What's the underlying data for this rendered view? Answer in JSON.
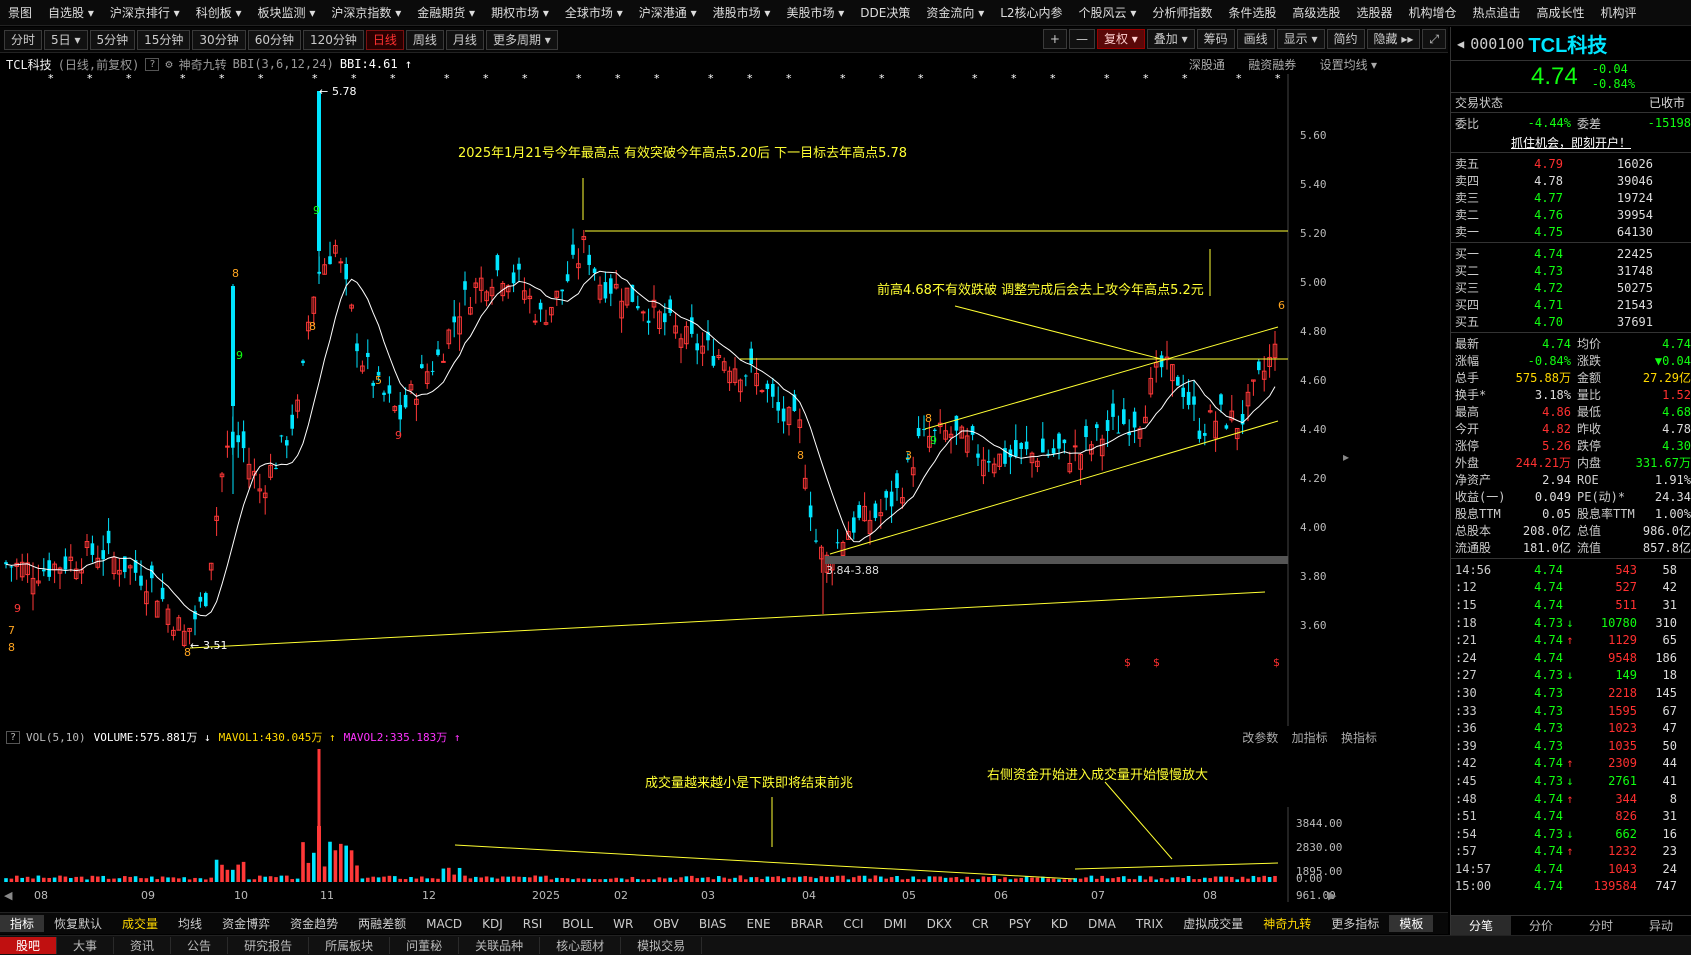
{
  "top_menu": [
    "景图",
    "自选股 ▾",
    "沪深京排行 ▾",
    "科创板 ▾",
    "板块监测 ▾",
    "沪深京指数 ▾",
    "金融期货 ▾",
    "期权市场 ▾",
    "全球市场 ▾",
    "沪深港通 ▾",
    "港股市场 ▾",
    "美股市场 ▾",
    "DDE决策",
    "资金流向 ▾",
    "L2核心内参",
    "个股风云 ▾",
    "分析师指数",
    "条件选股",
    "高级选股",
    "选股器",
    "机构增仓",
    "热点追击",
    "高成长性",
    "机构评"
  ],
  "periods": [
    "分时",
    "5日 ▾",
    "5分钟",
    "15分钟",
    "30分钟",
    "60分钟",
    "120分钟",
    "日线",
    "周线",
    "月线",
    "更多周期 ▾"
  ],
  "active_period": "日线",
  "toolbar_right": [
    "+",
    "—",
    "复权 ▾",
    "叠加 ▾",
    "筹码",
    "画线",
    "显示 ▾",
    "简约",
    "隐藏 ▸▸",
    "⤢"
  ],
  "info": {
    "name": "TCL科技",
    "mode": "(日线,前复权)",
    "help": "?",
    "indicator": "神奇九转",
    "bbi": "BBI(3,6,12,24)",
    "bbi_value": "BBI:4.61 ↑",
    "links": [
      "深股通",
      "融资融券",
      "设置均线 ▾"
    ]
  },
  "chart": {
    "y_ticks": [
      "5.60",
      "5.40",
      "5.20",
      "5.00",
      "4.80",
      "4.60",
      "4.40",
      "4.20",
      "4.00",
      "3.80",
      "3.60"
    ],
    "annotations": {
      "top_note": "2025年1月21号今年最高点 有效突破今年高点5.20后 下一目标去年高点5.78",
      "right_note": "前高4.68不有效跌破 调整完成后会去上攻今年高点5.2元",
      "high_label": "5.78",
      "low_label": "3.51",
      "range_label": "3.84-3.88"
    }
  },
  "vol_info": {
    "title": "VOL(5,10)",
    "volume": "VOLUME:575.881万 ↓",
    "mavol1": "MAVOL1:430.045万 ↑",
    "mavol2": "MAVOL2:335.183万 ↑",
    "links": [
      "改参数",
      "加指标",
      "换指标"
    ]
  },
  "vol": {
    "y_ticks": [
      "3844.00",
      "2830.00",
      "1895.00",
      "961.00",
      "0.00"
    ],
    "note_left": "成交量越来越小是下跌即将结束前兆",
    "note_right": "右侧资金开始进入成交量开始慢慢放大",
    "x_labels": [
      "08",
      "09",
      "10",
      "11",
      "12",
      "2025",
      "02",
      "03",
      "04",
      "05",
      "06",
      "07",
      "08"
    ]
  },
  "indicators": [
    "指标",
    "恢复默认",
    "成交量",
    "均线",
    "资金博弈",
    "资金趋势",
    "两融差额",
    "MACD",
    "KDJ",
    "RSI",
    "BOLL",
    "WR",
    "OBV",
    "BIAS",
    "ENE",
    "BRAR",
    "CCI",
    "DMI",
    "DKX",
    "CR",
    "PSY",
    "KD",
    "DMA",
    "TRIX",
    "虚拟成交量",
    "神奇九转",
    "更多指标",
    "模板"
  ],
  "bottom_tabs": [
    "股吧",
    "大事",
    "资讯",
    "公告",
    "研究报告",
    "所属板块",
    "问董秘",
    "关联品种",
    "核心题材",
    "模拟交易"
  ],
  "quote": {
    "code": "000100",
    "name": "TCL科技",
    "price": "4.74",
    "change": "-0.04",
    "change_pct": "-0.84%",
    "status_label": "交易状态",
    "status_value": "已收市",
    "weibi_label": "委比",
    "weibi": "-4.44%",
    "weicha_label": "委差",
    "weicha": "-15198",
    "promo": "抓住机会，即刻开户！",
    "asks": [
      [
        "卖五",
        "4.79",
        "16026"
      ],
      [
        "卖四",
        "4.78",
        "39046"
      ],
      [
        "卖三",
        "4.77",
        "19724"
      ],
      [
        "卖二",
        "4.76",
        "39954"
      ],
      [
        "卖一",
        "4.75",
        "64130"
      ]
    ],
    "bids": [
      [
        "买一",
        "4.74",
        "22425"
      ],
      [
        "买二",
        "4.73",
        "31748"
      ],
      [
        "买三",
        "4.72",
        "50275"
      ],
      [
        "买四",
        "4.71",
        "21543"
      ],
      [
        "买五",
        "4.70",
        "37691"
      ]
    ],
    "stats": [
      [
        "最新",
        "4.74",
        "均价",
        "4.74"
      ],
      [
        "涨幅",
        "-0.84%",
        "涨跌",
        "▼0.04"
      ],
      [
        "总手",
        "575.88万",
        "金额",
        "27.29亿"
      ],
      [
        "换手*",
        "3.18%",
        "量比",
        "1.52"
      ],
      [
        "最高",
        "4.86",
        "最低",
        "4.68"
      ],
      [
        "今开",
        "4.82",
        "昨收",
        "4.78"
      ],
      [
        "涨停",
        "5.26",
        "跌停",
        "4.30"
      ],
      [
        "外盘",
        "244.21万",
        "内盘",
        "331.67万"
      ],
      [
        "净资产",
        "2.94",
        "ROE",
        "1.91%"
      ],
      [
        "收益(一)",
        "0.049",
        "PE(动)*",
        "24.34"
      ],
      [
        "股息TTM",
        "0.05",
        "股息率TTM",
        "1.00%"
      ],
      [
        "总股本",
        "208.0亿",
        "总值",
        "986.0亿"
      ],
      [
        "流通股",
        "181.0亿",
        "流值",
        "857.8亿"
      ]
    ],
    "ticks": [
      [
        "14:56",
        "4.74",
        "",
        "543",
        "58"
      ],
      [
        ":12",
        "4.74",
        "",
        "527",
        "42"
      ],
      [
        ":15",
        "4.74",
        "",
        "511",
        "31"
      ],
      [
        ":18",
        "4.73",
        "↓",
        "10780",
        "310"
      ],
      [
        ":21",
        "4.74",
        "↑",
        "1129",
        "65"
      ],
      [
        ":24",
        "4.74",
        "",
        "9548",
        "186"
      ],
      [
        ":27",
        "4.73",
        "↓",
        "149",
        "18"
      ],
      [
        ":30",
        "4.73",
        "",
        "2218",
        "145"
      ],
      [
        ":33",
        "4.73",
        "",
        "1595",
        "67"
      ],
      [
        ":36",
        "4.73",
        "",
        "1023",
        "47"
      ],
      [
        ":39",
        "4.73",
        "",
        "1035",
        "50"
      ],
      [
        ":42",
        "4.74",
        "↑",
        "2309",
        "44"
      ],
      [
        ":45",
        "4.73",
        "↓",
        "2761",
        "41"
      ],
      [
        ":48",
        "4.74",
        "↑",
        "344",
        "8"
      ],
      [
        ":51",
        "4.74",
        "",
        "826",
        "31"
      ],
      [
        ":54",
        "4.73",
        "↓",
        "662",
        "16"
      ],
      [
        ":57",
        "4.74",
        "↑",
        "1232",
        "23"
      ],
      [
        "14:57",
        "4.74",
        "",
        "1043",
        "24"
      ],
      [
        "15:00",
        "4.74",
        "",
        "139584",
        "747"
      ]
    ],
    "tabs": [
      "分笔",
      "分价",
      "分时",
      "异动"
    ]
  }
}
